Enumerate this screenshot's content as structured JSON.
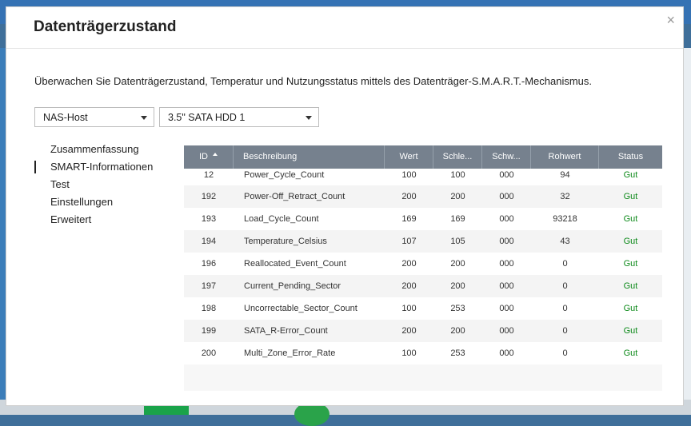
{
  "dialog": {
    "title": "Datenträgerzustand",
    "close_glyph": "×",
    "description": "Überwachen Sie Datenträgerzustand, Temperatur und Nutzungsstatus mittels des Datenträger-S.M.A.R.T.-Mechanismus."
  },
  "selectors": {
    "host": "NAS-Host",
    "disk": "3.5\" SATA HDD 1"
  },
  "nav": {
    "items": [
      "Zusammenfassung",
      "SMART-Informationen",
      "Test",
      "Einstellungen",
      "Erweitert"
    ],
    "active": "SMART-Informationen"
  },
  "table": {
    "headers": [
      "ID",
      "Beschreibung",
      "Wert",
      "Schle...",
      "Schw...",
      "Rohwert",
      "Status"
    ],
    "sort_column": "ID",
    "sort_direction": "ascending",
    "rows": [
      [
        "12",
        "Power_Cycle_Count",
        "100",
        "100",
        "000",
        "94",
        "Gut"
      ],
      [
        "192",
        "Power-Off_Retract_Count",
        "200",
        "200",
        "000",
        "32",
        "Gut"
      ],
      [
        "193",
        "Load_Cycle_Count",
        "169",
        "169",
        "000",
        "93218",
        "Gut"
      ],
      [
        "194",
        "Temperature_Celsius",
        "107",
        "105",
        "000",
        "43",
        "Gut"
      ],
      [
        "196",
        "Reallocated_Event_Count",
        "200",
        "200",
        "000",
        "0",
        "Gut"
      ],
      [
        "197",
        "Current_Pending_Sector",
        "200",
        "200",
        "000",
        "0",
        "Gut"
      ],
      [
        "198",
        "Uncorrectable_Sector_Count",
        "100",
        "253",
        "000",
        "0",
        "Gut"
      ],
      [
        "199",
        "SATA_R-Error_Count",
        "200",
        "200",
        "000",
        "0",
        "Gut"
      ],
      [
        "200",
        "Multi_Zone_Error_Rate",
        "100",
        "253",
        "000",
        "0",
        "Gut"
      ]
    ]
  },
  "colors": {
    "header_bg": "#76818e",
    "status_good": "#0d8a1a"
  }
}
